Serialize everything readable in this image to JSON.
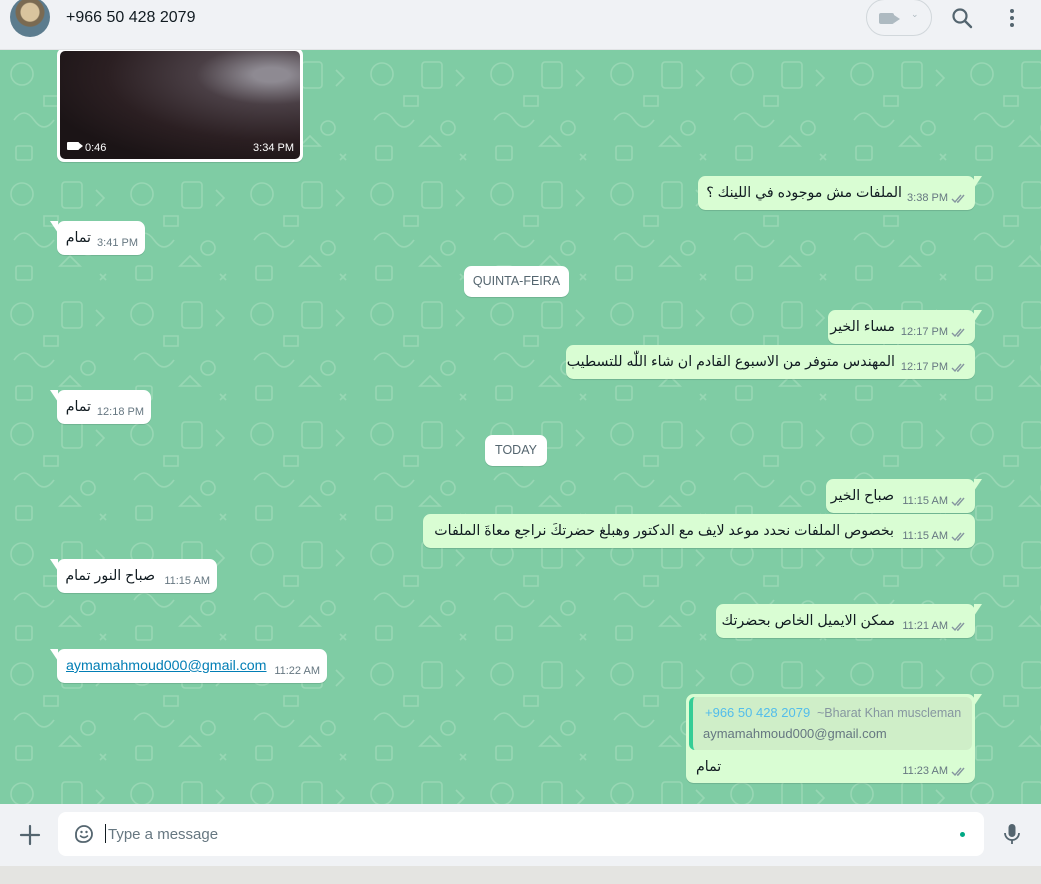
{
  "header": {
    "contact_name": "+966 50 428 2079",
    "icons": [
      "video-camera-icon",
      "chevron-down-icon",
      "search-icon",
      "menu-dots-icon"
    ]
  },
  "colors": {
    "chat_background": "#7fcca4",
    "incoming_bubble": "#ffffff",
    "outgoing_bubble": "#d9fdd3",
    "link": "#027eb5",
    "quote_name": "#53bdeb",
    "accent": "#00a884"
  },
  "messages": {
    "video": {
      "duration": "0:46",
      "time": "3:34 PM"
    },
    "m1": {
      "text": "الملفات مش موجوده في اللينك ؟",
      "time": "3:38 PM",
      "direction": "out"
    },
    "m2": {
      "text": "تمام",
      "time": "3:41 PM",
      "direction": "in"
    },
    "date1": "QUINTA-FEIRA",
    "m3": {
      "text": "مساء الخير",
      "time": "12:17 PM",
      "direction": "out"
    },
    "m4": {
      "text": "المهندس متوفر من الاسبوع القادم ان شاء اللّٰه للتسطيب",
      "time": "12:17 PM",
      "direction": "out"
    },
    "m5": {
      "text": "تمام",
      "time": "12:18 PM",
      "direction": "in"
    },
    "date2": "TODAY",
    "m6": {
      "text": "صباح الخير",
      "time": "11:15 AM",
      "direction": "out"
    },
    "m7": {
      "text": "بخصوص الملفات نحدد موعد لايف مع الدكتور وهبلغ حضرتكَ نراجع معاةَ الملفات",
      "time": "11:15 AM",
      "direction": "out"
    },
    "m8": {
      "text": "صباح النور تمام",
      "time": "11:15 AM",
      "direction": "in"
    },
    "m9": {
      "text": "ممكن الايميل الخاص بحضرتك",
      "time": "11:21 AM",
      "direction": "out"
    },
    "m10": {
      "text": "aymamahmoud000@gmail.com",
      "time": "11:22 AM",
      "direction": "in"
    },
    "m11": {
      "quote_number": "+966 50 428 2079",
      "quote_name": "~Bharat Khan muscleman",
      "quote_text": "aymamahmoud000@gmail.com",
      "text": "تمام",
      "time": "11:23 AM",
      "direction": "out"
    }
  },
  "composer": {
    "placeholder": "Type a message",
    "value": "",
    "icons": [
      "plus-icon",
      "sticker-icon",
      "microphone-icon"
    ]
  }
}
